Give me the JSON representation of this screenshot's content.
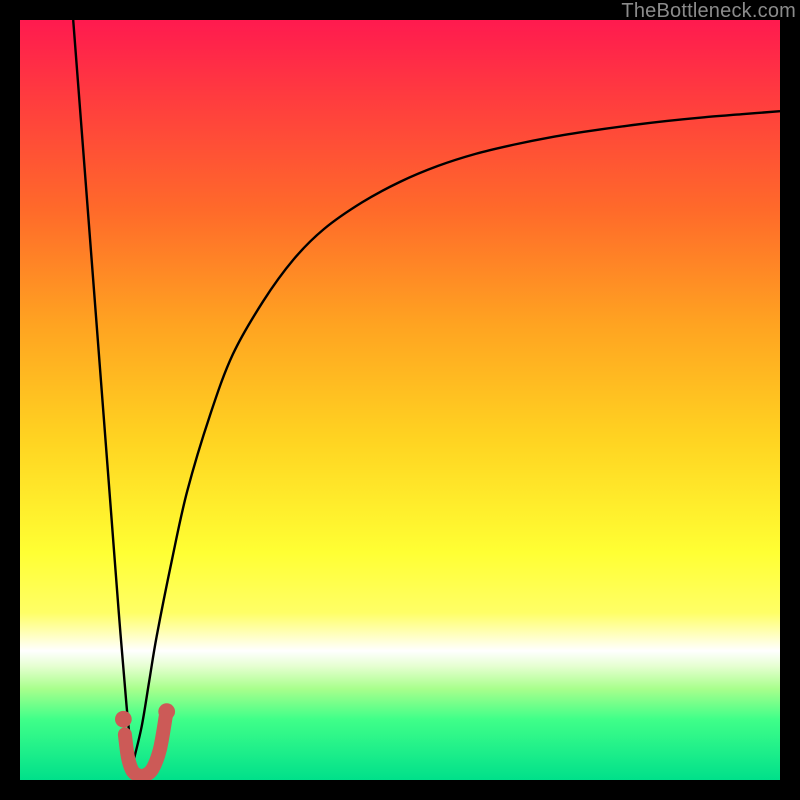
{
  "watermark": "TheBottleneck.com",
  "colors": {
    "curve_black": "#000000",
    "marker_red": "#cc5a57"
  },
  "chart_data": {
    "type": "line",
    "title": "",
    "xlabel": "",
    "ylabel": "",
    "xlim": [
      0,
      100
    ],
    "ylim": [
      0,
      100
    ],
    "grid": false,
    "legend": false,
    "note": "Axes are unlabeled in source image; x and y run 0–100 in plot-area percent. Higher y = higher bottleneck. Curve dips to ~0 near x≈15 then asymptotes toward ~88.",
    "series": [
      {
        "name": "left-branch",
        "style": "black-thin",
        "x": [
          7.0,
          8.0,
          9.0,
          10.0,
          11.0,
          12.0,
          13.0,
          14.0,
          14.8
        ],
        "y": [
          100.0,
          87.0,
          74.0,
          61.0,
          48.0,
          35.0,
          22.0,
          10.0,
          2.0
        ]
      },
      {
        "name": "right-branch",
        "style": "black-thin",
        "x": [
          14.8,
          16,
          17,
          18,
          20,
          22,
          25,
          28,
          32,
          36,
          40,
          45,
          50,
          55,
          60,
          65,
          70,
          75,
          80,
          85,
          90,
          95,
          100
        ],
        "y": [
          2.0,
          7,
          13,
          19,
          29,
          38,
          48,
          56,
          63,
          68.5,
          72.5,
          76,
          78.7,
          80.8,
          82.4,
          83.6,
          84.6,
          85.4,
          86.1,
          86.7,
          87.2,
          87.6,
          88.0
        ]
      },
      {
        "name": "bottom-hook",
        "style": "coral-thick",
        "x": [
          13.8,
          14.2,
          14.8,
          15.6,
          16.4,
          17.4,
          18.4,
          19.2
        ],
        "y": [
          6.0,
          3.0,
          1.2,
          0.6,
          0.6,
          1.4,
          4.0,
          8.5
        ]
      }
    ],
    "markers": [
      {
        "name": "dot-left",
        "x": 13.6,
        "y": 8.0,
        "r": 1.1,
        "color": "#cc5a57"
      },
      {
        "name": "dot-bottom",
        "x": 19.3,
        "y": 9.0,
        "r": 1.1,
        "color": "#cc5a57"
      }
    ]
  }
}
